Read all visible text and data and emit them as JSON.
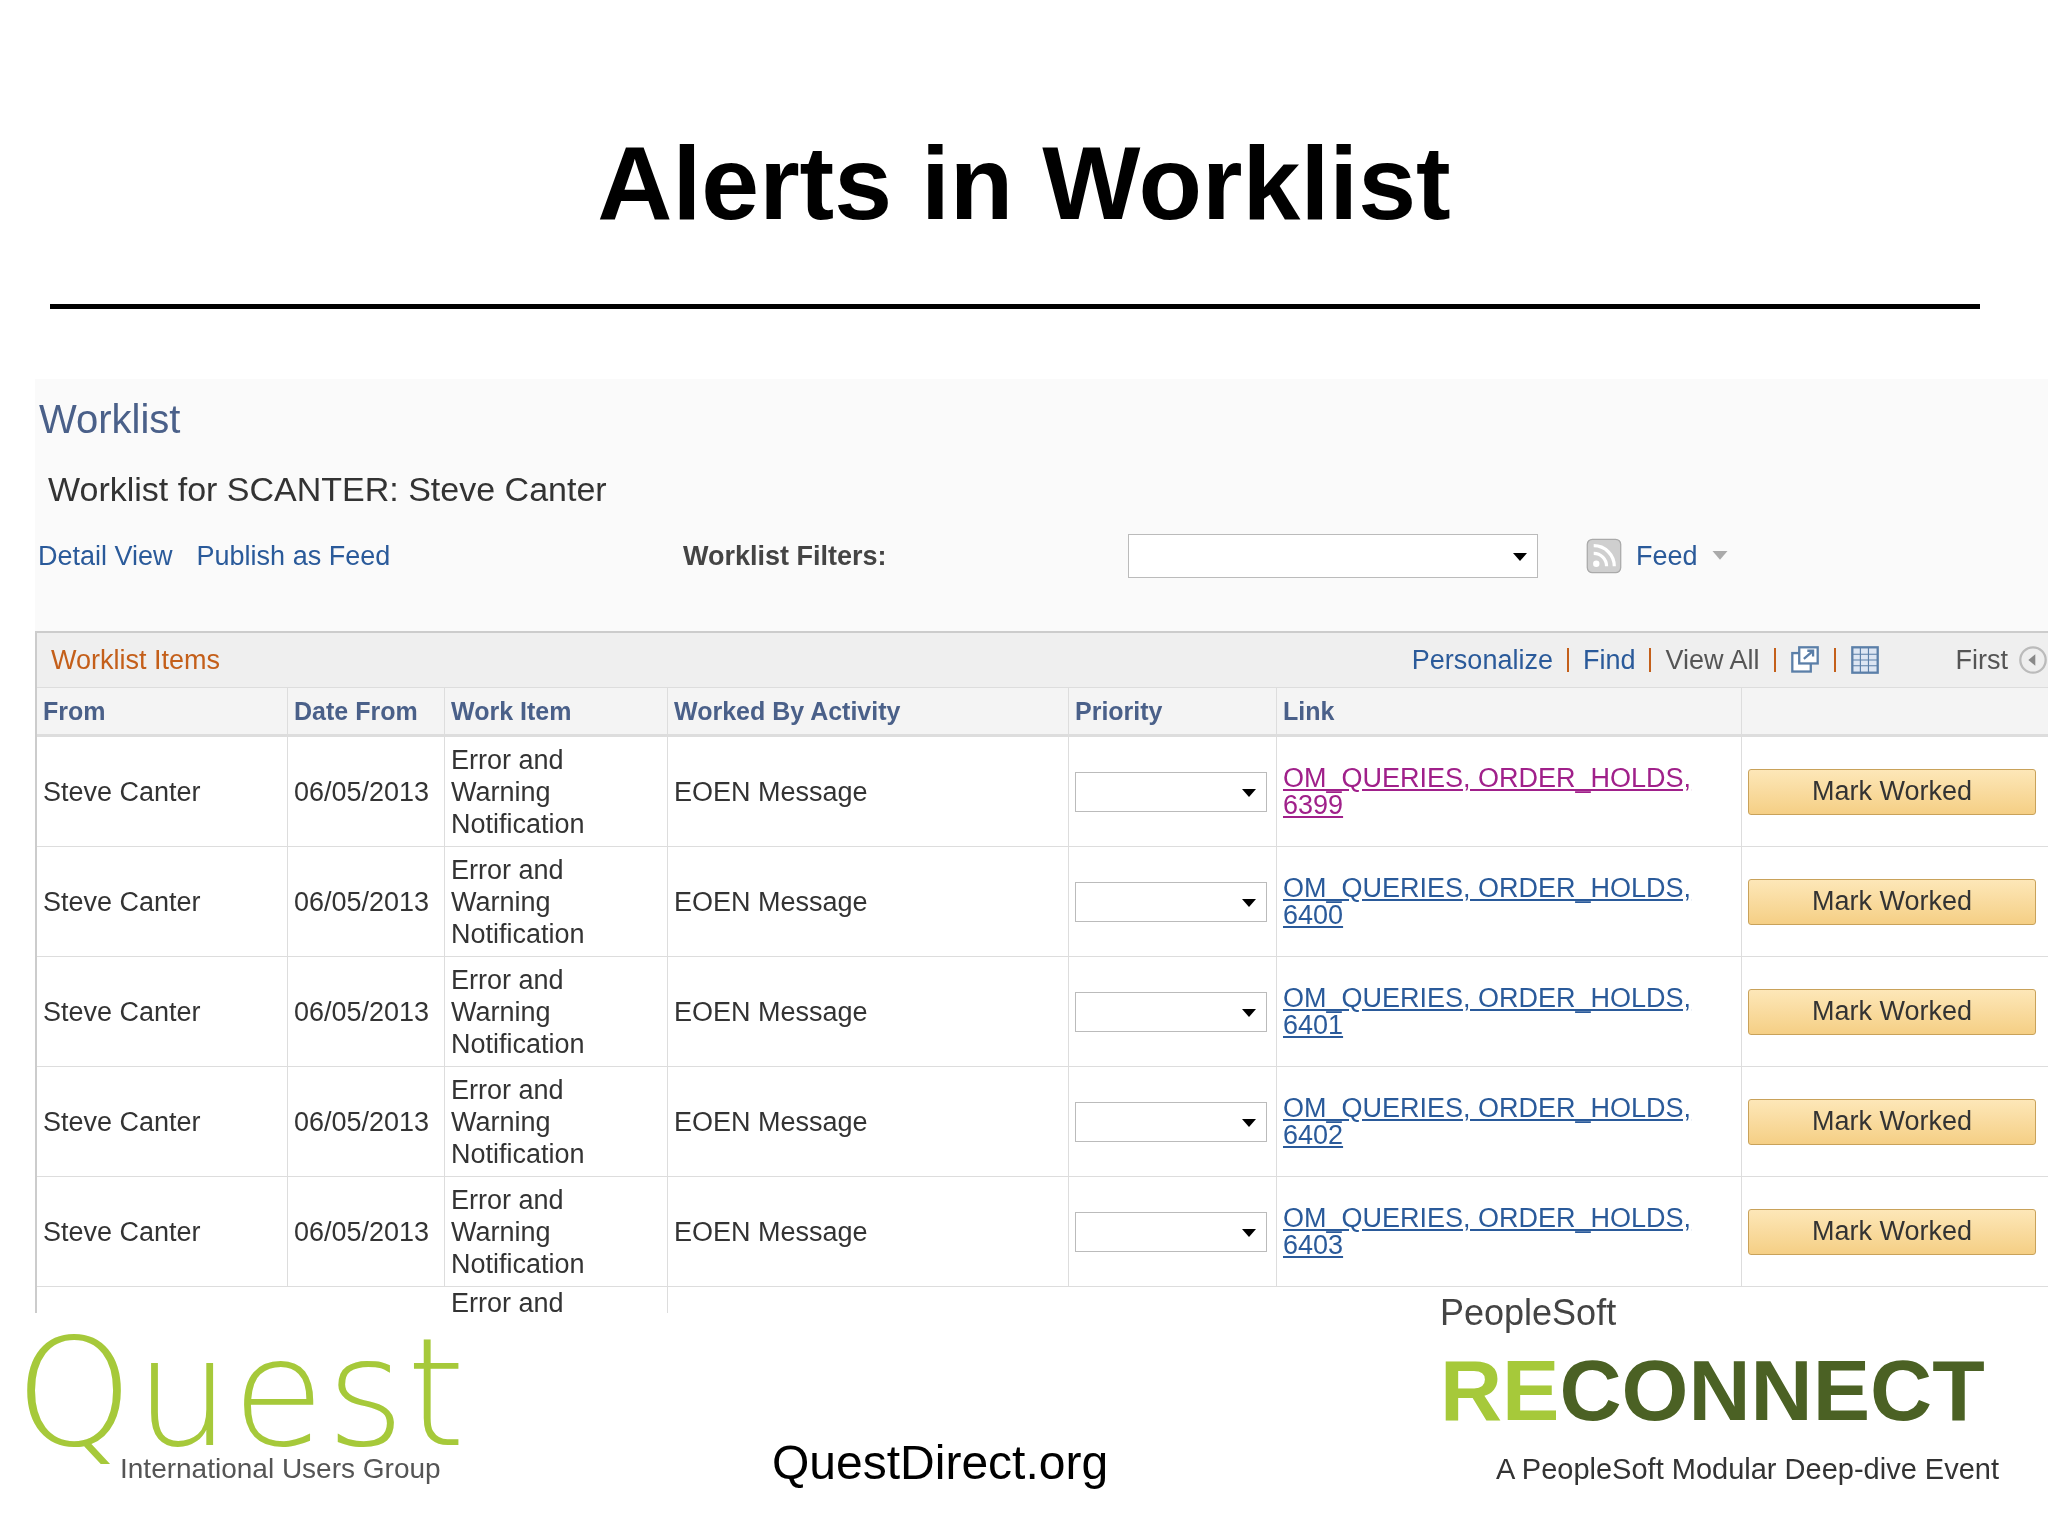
{
  "slide_title": "Alerts in Worklist",
  "page": {
    "title": "Worklist",
    "subtitle": "Worklist for SCANTER: Steve Canter",
    "links": [
      "Detail View",
      "Publish as Feed"
    ],
    "filters_label": "Worklist Filters:",
    "feed_label": "Feed"
  },
  "grid": {
    "title": "Worklist Items",
    "toolbar": [
      {
        "kind": "link",
        "label": "Personalize"
      },
      {
        "kind": "link",
        "label": "Find"
      },
      {
        "kind": "text",
        "label": "View All"
      },
      {
        "kind": "zoom"
      },
      {
        "kind": "download"
      }
    ],
    "nav_label": "First",
    "columns": [
      "From",
      "Date From",
      "Work Item",
      "Worked By Activity",
      "Priority",
      "Link"
    ],
    "rows": [
      {
        "from": "Steve Canter",
        "date_from": "06/05/2013",
        "work_item": "Error and Warning Notification",
        "activity": "EOEN Message",
        "link": "OM_QUERIES, ORDER_HOLDS, 6399",
        "visited": true,
        "button": "Mark Worked"
      },
      {
        "from": "Steve Canter",
        "date_from": "06/05/2013",
        "work_item": "Error and Warning Notification",
        "activity": "EOEN Message",
        "link": "OM_QUERIES, ORDER_HOLDS, 6400",
        "visited": false,
        "button": "Mark Worked"
      },
      {
        "from": "Steve Canter",
        "date_from": "06/05/2013",
        "work_item": "Error and Warning Notification",
        "activity": "EOEN Message",
        "link": "OM_QUERIES, ORDER_HOLDS, 6401",
        "visited": false,
        "button": "Mark Worked"
      },
      {
        "from": "Steve Canter",
        "date_from": "06/05/2013",
        "work_item": "Error and Warning Notification",
        "activity": "EOEN Message",
        "link": "OM_QUERIES, ORDER_HOLDS, 6402",
        "visited": false,
        "button": "Mark Worked"
      },
      {
        "from": "Steve Canter",
        "date_from": "06/05/2013",
        "work_item": "Error and Warning Notification",
        "activity": "EOEN Message",
        "link": "OM_QUERIES, ORDER_HOLDS, 6403",
        "visited": false,
        "button": "Mark Worked"
      }
    ],
    "partial_row": {
      "work_item": "Error and"
    }
  },
  "footer": {
    "left_logo": "Quest",
    "left_tagline": "International Users Group",
    "url": "QuestDirect.org",
    "right_top": "PeopleSoft",
    "right_logo_prefix": "RE",
    "right_logo_rest": "CONNECT",
    "right_tagline": "A PeopleSoft Modular Deep-dive Event"
  }
}
